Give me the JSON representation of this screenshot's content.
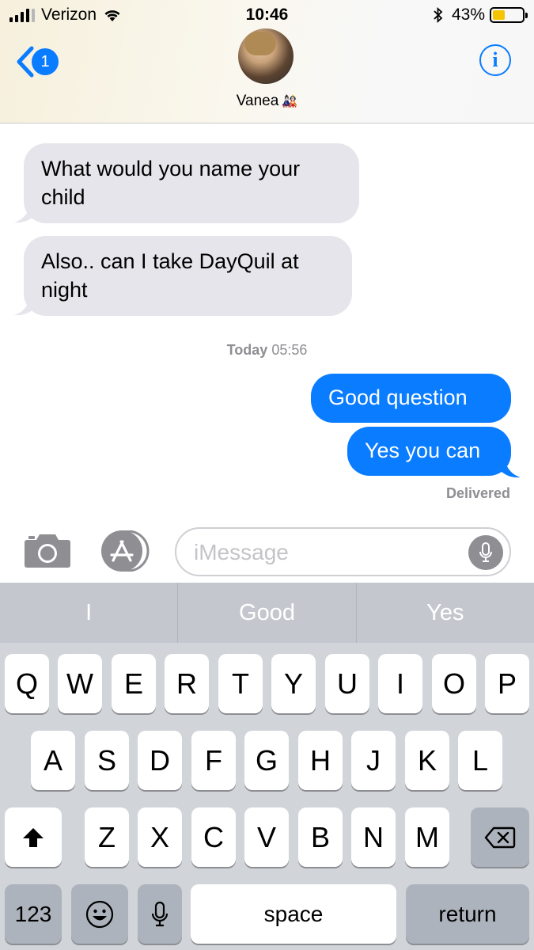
{
  "status_bar": {
    "carrier": "Verizon",
    "time": "10:46",
    "battery_percent": "43%",
    "battery_level": 0.43
  },
  "header": {
    "back_badge": "1",
    "contact_name": "Vanea",
    "contact_emoji": "🎎",
    "info_label": "i"
  },
  "messages": {
    "received": [
      {
        "text": "What would you name your child"
      },
      {
        "text": "Also.. can I take DayQuil at night"
      }
    ],
    "timestamp_day": "Today",
    "timestamp_time": "05:56",
    "sent": [
      {
        "text": "Good question"
      },
      {
        "text": "Yes you can"
      }
    ],
    "delivered_label": "Delivered"
  },
  "input": {
    "placeholder": "iMessage"
  },
  "keyboard": {
    "suggestions": [
      "I",
      "Good",
      "Yes"
    ],
    "row1": [
      "Q",
      "W",
      "E",
      "R",
      "T",
      "Y",
      "U",
      "I",
      "O",
      "P"
    ],
    "row2": [
      "A",
      "S",
      "D",
      "F",
      "G",
      "H",
      "J",
      "K",
      "L"
    ],
    "row3": [
      "Z",
      "X",
      "C",
      "V",
      "B",
      "N",
      "M"
    ],
    "numbers_label": "123",
    "space_label": "space",
    "return_label": "return"
  },
  "colors": {
    "accent": "#0a7cff",
    "received_bubble": "#e6e5eb",
    "keyboard_bg": "#d1d4d9"
  }
}
